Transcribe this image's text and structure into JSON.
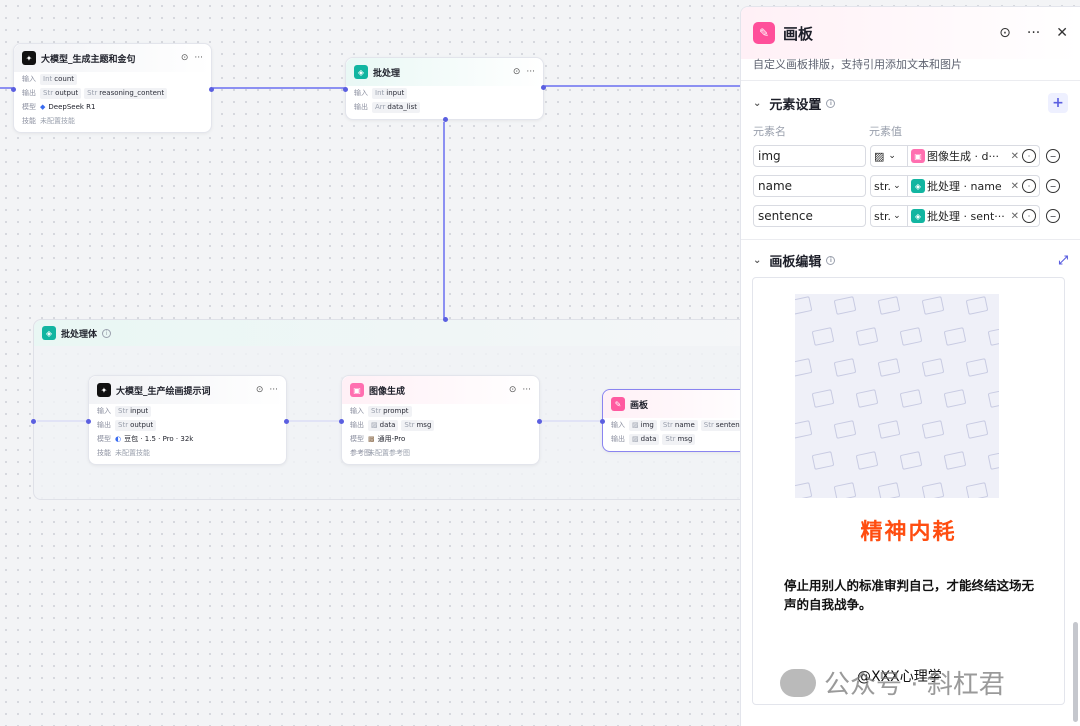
{
  "canvas": {
    "node_llm1": {
      "title": "大模型_生成主题和金句",
      "input_label": "输入",
      "input_type": "Int",
      "input": "count",
      "output_label": "输出",
      "output_type": "Str",
      "output": "output",
      "output2_type": "Str",
      "output2": "reasoning_content",
      "model_label": "模型",
      "model": "DeepSeek R1",
      "skill_label": "技能",
      "skill": "未配置技能"
    },
    "node_batch": {
      "title": "批处理",
      "input_label": "输入",
      "input_type": "Int",
      "input": "input",
      "output_label": "输出",
      "output_type": "Arr",
      "output": "data_list"
    },
    "group": {
      "title": "批处理体"
    },
    "node_llm2": {
      "title": "大模型_生产绘画提示词",
      "input_label": "输入",
      "input_type": "Str",
      "input": "input",
      "output_label": "输出",
      "output_type": "Str",
      "output": "output",
      "model_label": "模型",
      "model": "豆包 · 1.5 · Pro · 32k",
      "skill_label": "技能",
      "skill": "未配置技能"
    },
    "node_img": {
      "title": "图像生成",
      "input_label": "输入",
      "input_type": "Str",
      "input": "prompt",
      "output_label": "输出",
      "output1": "data",
      "output2_type": "Str",
      "output2": "msg",
      "model_label": "模型",
      "model": "通用-Pro",
      "ref_label": "参考图",
      "ref": "未配置参考图"
    },
    "node_board": {
      "title": "画板",
      "input_label": "输入",
      "input1": "img",
      "input2_type": "Str",
      "input2": "name",
      "input3_type": "Str",
      "input3": "sentence",
      "output_label": "输出",
      "output1": "data",
      "output2_type": "Str",
      "output2": "msg"
    }
  },
  "panel": {
    "title": "画板",
    "description": "自定义画板排版，支持引用添加文本和图片",
    "elements_section": "元素设置",
    "col_name": "元素名",
    "col_value": "元素值",
    "elements": [
      {
        "name": "img",
        "type": "",
        "value": "图像生成 · d···"
      },
      {
        "name": "name",
        "type": "str.",
        "value": "批处理 · name"
      },
      {
        "name": "sentence",
        "type": "str.",
        "value": "批处理 · sent···"
      }
    ],
    "editor_section": "画板编辑",
    "preview": {
      "headline": "精神内耗",
      "body": "停止用别人的标准审判自己，才能终结这场无声的自我战争。",
      "signature": "@XXX心理学"
    }
  },
  "watermark": {
    "text": "公众号 · 斜杠君"
  },
  "colors": {
    "accent": "#5b5fe0",
    "headline": "#ff4d10",
    "board_icon": "#ff4f9a",
    "batch_icon": "#12b5a1"
  }
}
